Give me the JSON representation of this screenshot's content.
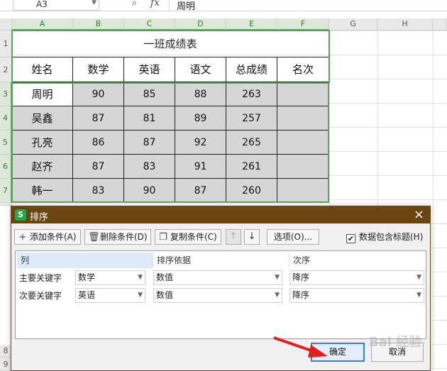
{
  "formula_bar": {
    "cell_ref": "A3",
    "fx": "fx",
    "value": "周明"
  },
  "columns": [
    "A",
    "B",
    "C",
    "D",
    "E",
    "F",
    "G",
    "H"
  ],
  "rows": [
    "1",
    "2",
    "3",
    "4",
    "5",
    "6",
    "7",
    "8",
    "9"
  ],
  "sheet": {
    "title": "一班成绩表",
    "headers": [
      "姓名",
      "数学",
      "英语",
      "语文",
      "总成绩",
      "名次"
    ],
    "data": [
      [
        "周明",
        "90",
        "85",
        "88",
        "263",
        ""
      ],
      [
        "吴鑫",
        "87",
        "81",
        "89",
        "257",
        ""
      ],
      [
        "孔亮",
        "86",
        "87",
        "92",
        "265",
        ""
      ],
      [
        "赵齐",
        "87",
        "83",
        "91",
        "261",
        ""
      ],
      [
        "韩一",
        "83",
        "90",
        "87",
        "260",
        ""
      ]
    ]
  },
  "dialog": {
    "title": "排序",
    "logo": "S",
    "close": "×",
    "toolbar": {
      "add": "添加条件(A)",
      "delete": "删除条件(D)",
      "copy": "复制条件(C)",
      "up": "↑",
      "down": "↓",
      "options": "选项(O)...",
      "has_header": "数据包含标题(H)",
      "has_header_checked": true
    },
    "list_headers": [
      "列",
      "排序依据",
      "次序"
    ],
    "conditions": [
      {
        "label": "主要关键字",
        "column": "数学",
        "basis": "数值",
        "order": "降序"
      },
      {
        "label": "次要关键字",
        "column": "英语",
        "basis": "数值",
        "order": "降序"
      }
    ],
    "ok": "确定",
    "cancel": "取消"
  },
  "icons": [
    "zoom-icon",
    "plus-icon",
    "trash-icon",
    "copy-icon",
    "arrow-up-icon",
    "arrow-down-icon",
    "checkbox-icon",
    "close-icon",
    "dropdown-arrow-icon"
  ],
  "colors": {
    "dialog_title_bg": "#6a4510",
    "selection": "#58a55a",
    "ok_border": "#3b7bd4",
    "annotation_arrow": "#e02020",
    "logo": "#2ca44e"
  },
  "watermark": "Bai 经验"
}
